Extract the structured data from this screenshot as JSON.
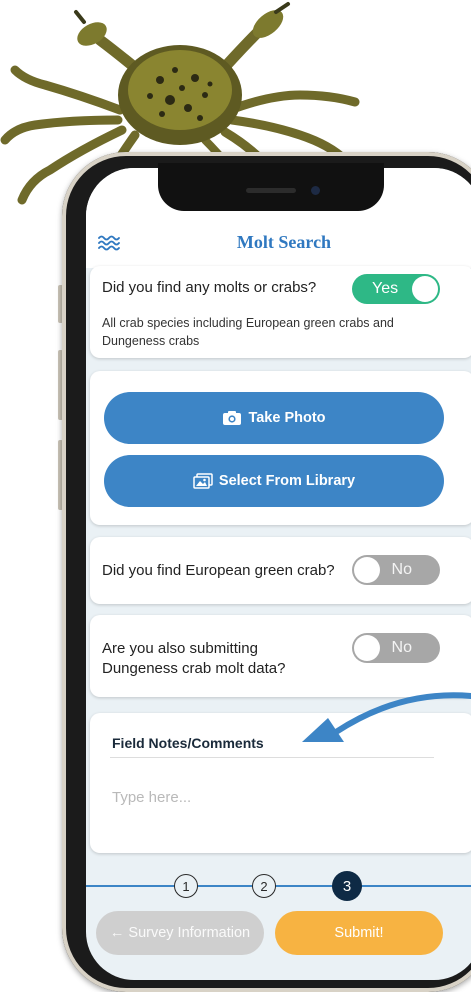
{
  "header": {
    "title": "Molt Search",
    "menu_icon": "waves-icon"
  },
  "molts_card": {
    "question": "Did you find any molts or crabs?",
    "toggle_label": "Yes",
    "toggle_state": "on",
    "description": "All crab species including European green crabs and Dungeness crabs"
  },
  "photo_card": {
    "take_photo_label": "Take Photo",
    "take_photo_icon": "camera-icon",
    "library_label": "Select From Library",
    "library_icon": "images-icon"
  },
  "green_crab_card": {
    "question": "Did you find European green crab?",
    "toggle_label": "No",
    "toggle_state": "off"
  },
  "dungeness_card": {
    "question_line1": "Are you also submitting",
    "question_line2": "Dungeness crab molt data?",
    "toggle_label": "No",
    "toggle_state": "off"
  },
  "notes_card": {
    "title": "Field Notes/Comments",
    "placeholder": "Type here...",
    "value": ""
  },
  "stepper": {
    "steps": [
      "1",
      "2",
      "3"
    ],
    "current": 3
  },
  "footer": {
    "back_label": "← Survey Information",
    "submit_label": "Submit!"
  },
  "colors": {
    "accent_blue": "#3d85c6",
    "toggle_on": "#2eb886",
    "toggle_off": "#a7a7a7",
    "submit": "#f7b342",
    "active_step": "#0e2a45"
  }
}
